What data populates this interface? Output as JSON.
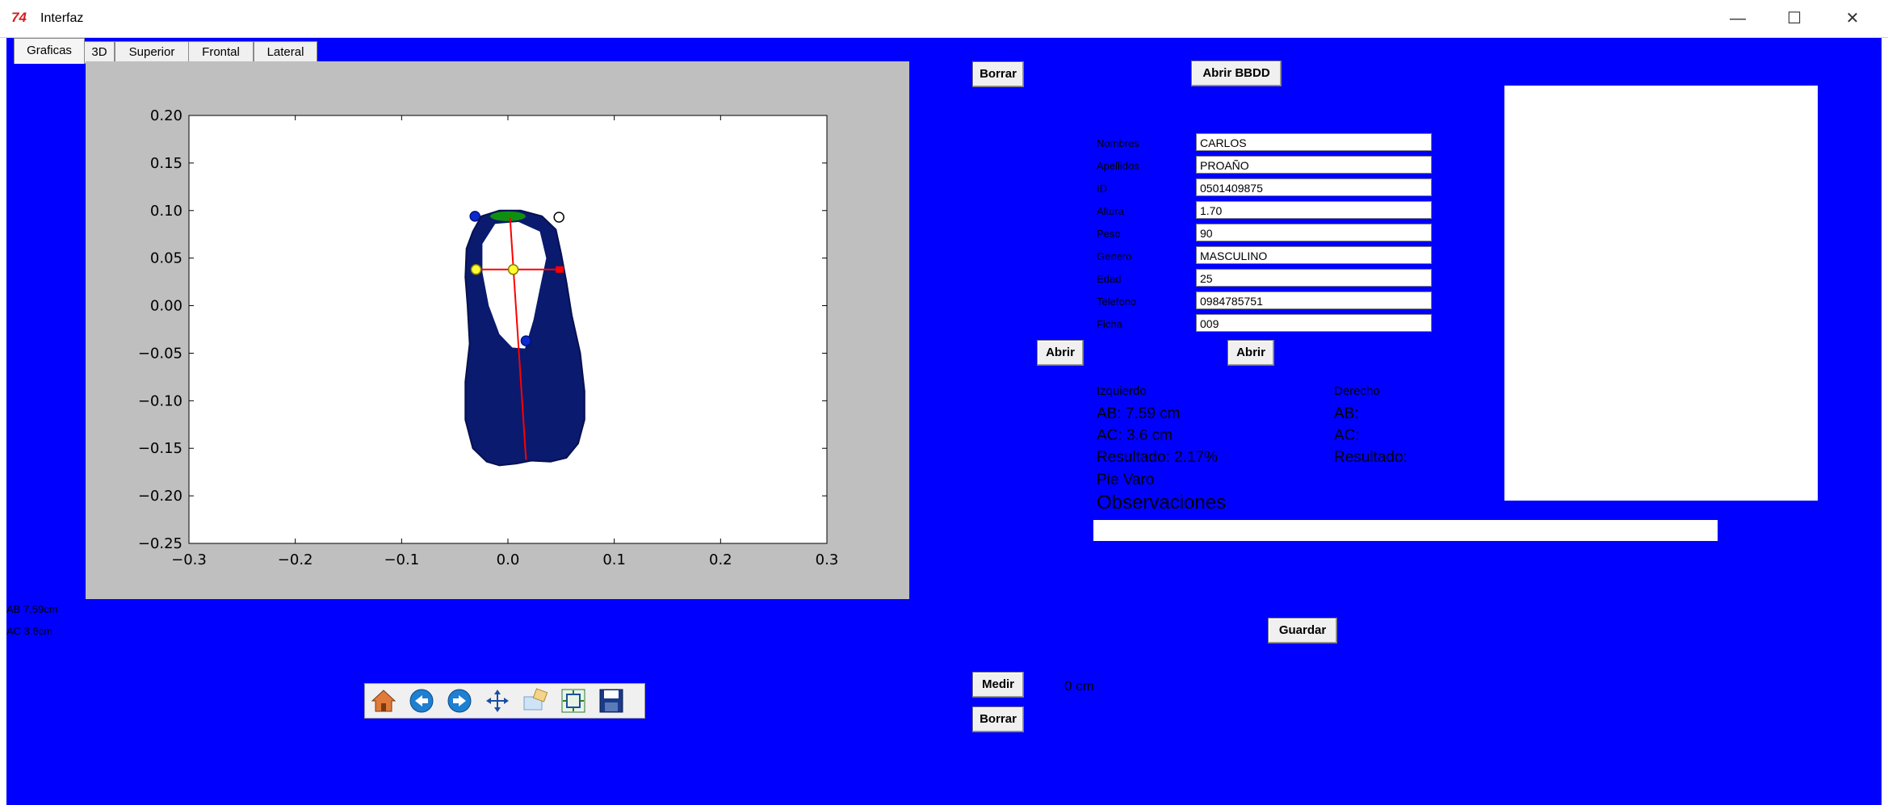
{
  "window": {
    "title": "Interfaz",
    "icon_glyph": "74",
    "icon": "tk-feather-icon",
    "controls": [
      "minimize-icon",
      "maximize-icon",
      "close-icon"
    ],
    "minimize_glyph": "—",
    "maximize_glyph": "☐",
    "close_glyph": "✕"
  },
  "tabs": [
    {
      "label": "Graficas",
      "active": true
    },
    {
      "label": "3D",
      "active": false
    },
    {
      "label": "Superior",
      "active": false
    },
    {
      "label": "Frontal",
      "active": false
    },
    {
      "label": "Lateral",
      "active": false
    }
  ],
  "chart_data": {
    "type": "scatter",
    "xlim": [
      -0.3,
      0.3
    ],
    "ylim": [
      -0.25,
      0.2
    ],
    "x_ticks": [
      "−0.3",
      "−0.2",
      "−0.1",
      "0.0",
      "0.1",
      "0.2",
      "0.3"
    ],
    "y_ticks": [
      "0.20",
      "0.15",
      "0.10",
      "0.05",
      "0.00",
      "−0.05",
      "−0.10",
      "−0.15",
      "−0.20",
      "−0.25"
    ],
    "grid": false,
    "footprint_color": "#0a1a6e",
    "toe_marker_color": "#0f8f0f",
    "measure_line_color": "#ff0000",
    "midpoint_color": "#ffff33",
    "points": [
      {
        "x": -0.031,
        "y": 0.094,
        "style": "blue"
      },
      {
        "x": 0.048,
        "y": 0.093,
        "style": "white"
      },
      {
        "x": -0.03,
        "y": 0.038,
        "style": "yellow"
      },
      {
        "x": 0.005,
        "y": 0.038,
        "style": "yellow"
      },
      {
        "x": 0.017,
        "y": -0.037,
        "style": "blue"
      }
    ],
    "horizontal_line": {
      "x1": -0.033,
      "x2": 0.048,
      "y": 0.038
    },
    "vertical_line": {
      "x1": 0.002,
      "y1": 0.092,
      "x2": 0.017,
      "y2": -0.162
    }
  },
  "plot_toolbar": [
    "home-icon",
    "back-arrow-icon",
    "forward-arrow-icon",
    "pan-icon",
    "zoom-icon",
    "configure-subplots-icon",
    "save-icon"
  ],
  "side_readout": {
    "ab": "AB 7.59cm",
    "ac": "AC 3.6cm"
  },
  "buttons": {
    "borrar_top": "Borrar",
    "abrir_bbdd": "Abrir BBDD",
    "abrir_left": "Abrir",
    "abrir_right": "Abrir",
    "guardar": "Guardar",
    "medir": "Medir",
    "borrar_bottom": "Borrar"
  },
  "form": {
    "nombres_label": "Nombres",
    "nombres": "CARLOS",
    "apellidos_label": "Apellidos",
    "apellidos": "PROAÑO",
    "id_label": "ID",
    "id": "0501409875",
    "altura_label": "Altura",
    "altura": "1.70",
    "peso_label": "Peso",
    "peso": "90",
    "genero_label": "Genero",
    "genero": "MASCULINO",
    "edad_label": "Edad",
    "edad": "25",
    "telefono_label": "Telefono",
    "telefono": "0984785751",
    "ficha_label": "Ficha",
    "ficha": "009"
  },
  "results": {
    "izquierdo_label": "Izquierdo",
    "derecho_label": "Derecho",
    "left_ab": "AB: 7.59 cm",
    "left_ac": "AC: 3.6 cm",
    "left_resultado": "Resultado: 2.17%",
    "left_pie": "Pie Varo",
    "right_ab": "AB:",
    "right_ac": "AC:",
    "right_resultado": "Resultado:",
    "observaciones_label": "Observaciones",
    "observaciones_value": ""
  },
  "measure": {
    "value": "0 cm"
  }
}
